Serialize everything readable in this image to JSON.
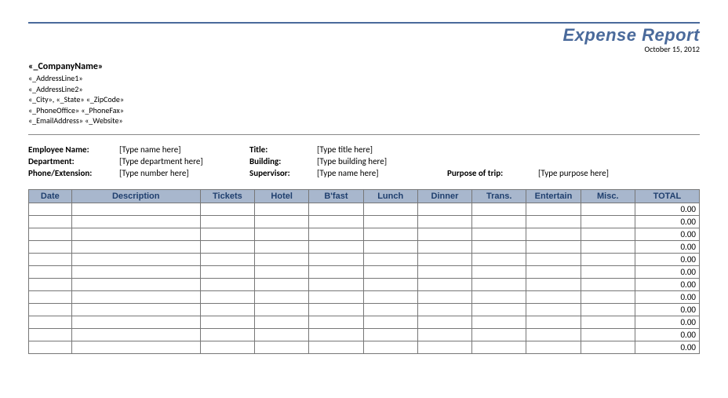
{
  "header": {
    "title": "Expense Report",
    "date": "October 15, 2012"
  },
  "company": {
    "name": "«_CompanyName»",
    "address1": "«_AddressLine1»",
    "address2": "«_AddressLine2»",
    "city_state_zip": "«_City», «_State»  «_ZipCode»",
    "phones": "«_PhoneOffice»  «_PhoneFax»",
    "email_web": "«_EmailAddress»  «_Website»"
  },
  "fields": {
    "employee_name_label": "Employee Name:",
    "employee_name_value": "[Type name here]",
    "title_label": "Title:",
    "title_value": "[Type title here]",
    "department_label": "Department:",
    "department_value": "[Type department here]",
    "building_label": "Building:",
    "building_value": "[Type building here]",
    "phone_label": "Phone/Extension:",
    "phone_value": "[Type number here]",
    "supervisor_label": "Supervisor:",
    "supervisor_value": "[Type name here]",
    "purpose_label": "Purpose of trip:",
    "purpose_value": "[Type purpose here]"
  },
  "table": {
    "headers": [
      "Date",
      "Description",
      "Tickets",
      "Hotel",
      "B'fast",
      "Lunch",
      "Dinner",
      "Trans.",
      "Entertain",
      "Misc.",
      "TOTAL"
    ],
    "row_count": 12,
    "default_total": "0.00"
  }
}
